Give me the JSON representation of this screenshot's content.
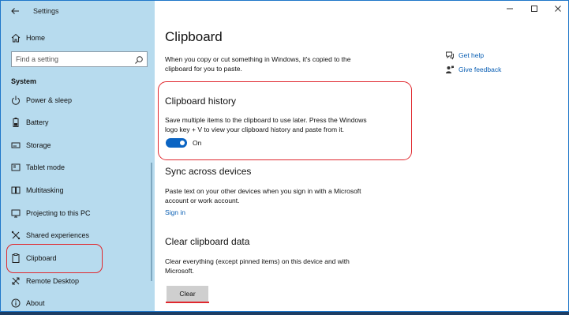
{
  "app": {
    "title": "Settings"
  },
  "sidebar": {
    "home_label": "Home",
    "search_placeholder": "Find a setting",
    "section_title": "System",
    "items": [
      {
        "label": "Power & sleep",
        "icon": "power-icon"
      },
      {
        "label": "Battery",
        "icon": "battery-icon"
      },
      {
        "label": "Storage",
        "icon": "storage-icon"
      },
      {
        "label": "Tablet mode",
        "icon": "tablet-icon"
      },
      {
        "label": "Multitasking",
        "icon": "multitasking-icon"
      },
      {
        "label": "Projecting to this PC",
        "icon": "projecting-icon"
      },
      {
        "label": "Shared experiences",
        "icon": "shared-icon"
      },
      {
        "label": "Clipboard",
        "icon": "clipboard-icon"
      },
      {
        "label": "Remote Desktop",
        "icon": "remote-desktop-icon"
      },
      {
        "label": "About",
        "icon": "info-icon"
      }
    ]
  },
  "main": {
    "title": "Clipboard",
    "intro": "When you copy or cut something in Windows, it's copied to the clipboard for you to paste.",
    "history": {
      "heading": "Clipboard history",
      "description": "Save multiple items to the clipboard to use later. Press the Windows logo key + V to view your clipboard history and paste from it.",
      "toggle_state": "On"
    },
    "sync": {
      "heading": "Sync across devices",
      "description": "Paste text on your other devices when you sign in with a Microsoft account or work account.",
      "link": "Sign in"
    },
    "clear": {
      "heading": "Clear clipboard data",
      "description": "Clear everything (except pinned items) on this device and with Microsoft.",
      "button": "Clear"
    },
    "help": {
      "get_help": "Get help",
      "give_feedback": "Give feedback"
    }
  },
  "colors": {
    "accent": "#0a64c3",
    "sidebar_bg": "#b7dbee",
    "highlight": "#e0282e",
    "link": "#0a5fb4"
  }
}
